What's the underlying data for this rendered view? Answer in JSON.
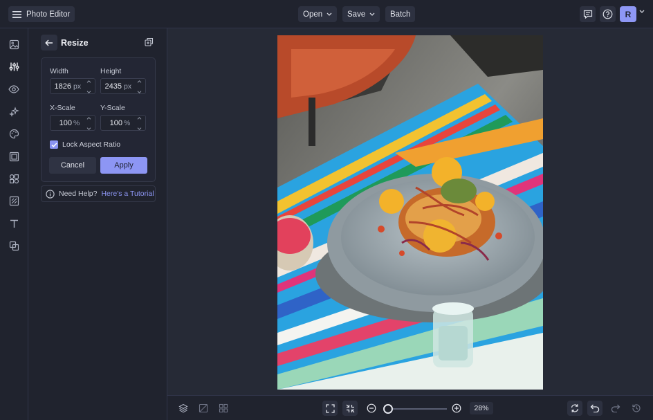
{
  "topbar": {
    "app_title": "Photo Editor",
    "open_label": "Open",
    "save_label": "Save",
    "batch_label": "Batch",
    "avatar_initial": "R"
  },
  "rail": {
    "items": [
      "image-icon",
      "sliders-icon",
      "eye-icon",
      "sparkles-icon",
      "palette-icon",
      "frame-icon",
      "shapes-icon",
      "texture-icon",
      "text-icon",
      "overlay-icon"
    ],
    "active_index": 1
  },
  "panel": {
    "title": "Resize",
    "width_label": "Width",
    "width_value": "1826",
    "width_unit": "px",
    "height_label": "Height",
    "height_value": "2435",
    "height_unit": "px",
    "xscale_label": "X-Scale",
    "xscale_value": "100",
    "xscale_unit": "%",
    "yscale_label": "Y-Scale",
    "yscale_value": "100",
    "yscale_unit": "%",
    "lock_label": "Lock Aspect Ratio",
    "lock_checked": true,
    "cancel_label": "Cancel",
    "apply_label": "Apply",
    "help_text": "Need Help?",
    "help_link": "Here's a Tutorial"
  },
  "bottombar": {
    "zoom_level": "28%",
    "zoom_fraction": 0.28
  },
  "colors": {
    "accent": "#8d96f4",
    "background": "#262a36",
    "panel": "#20232e"
  }
}
